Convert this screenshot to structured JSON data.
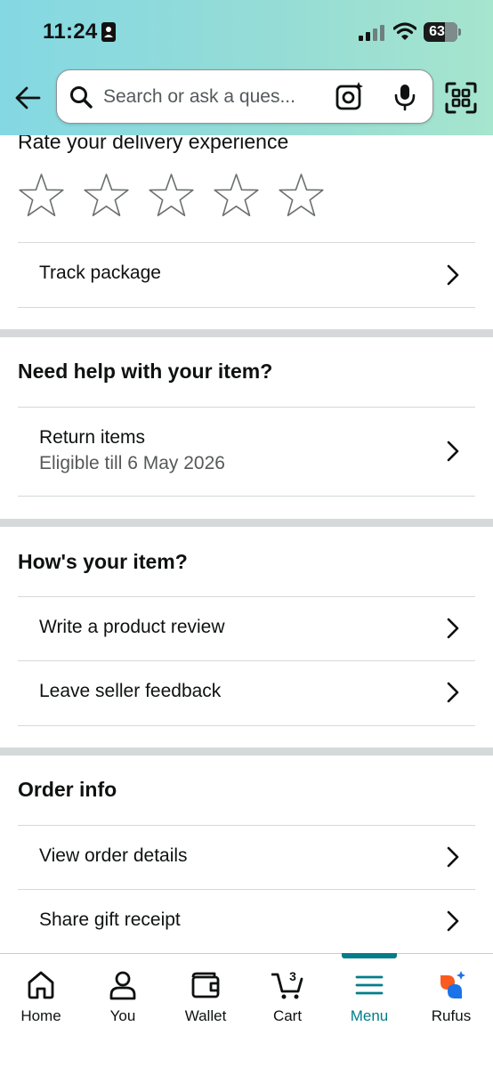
{
  "status_bar": {
    "time": "11:24",
    "battery": "63"
  },
  "search": {
    "placeholder": "Search or ask a ques..."
  },
  "rating": {
    "title": "Rate your delivery experience",
    "stars_total": 5,
    "stars_filled": 0
  },
  "delivery": {
    "track_label": "Track package"
  },
  "help_section": {
    "title": "Need help with your item?",
    "return_label": "Return items",
    "return_sub": "Eligible till 6 May 2026"
  },
  "item_section": {
    "title": "How's your item?",
    "review_label": "Write a product review",
    "feedback_label": "Leave seller feedback"
  },
  "order_section": {
    "title": "Order info",
    "details_label": "View order details",
    "gift_label": "Share gift receipt"
  },
  "bottom_nav": {
    "items": [
      {
        "label": "Home",
        "icon": "home-icon"
      },
      {
        "label": "You",
        "icon": "user-icon"
      },
      {
        "label": "Wallet",
        "icon": "wallet-icon"
      },
      {
        "label": "Cart",
        "icon": "cart-icon",
        "count": "3"
      },
      {
        "label": "Menu",
        "icon": "menu-icon",
        "active": true
      },
      {
        "label": "Rufus",
        "icon": "rufus-icon"
      }
    ]
  },
  "colors": {
    "header_gradient_start": "#84d8e3",
    "header_gradient_end": "#a6e5ce",
    "active_teal": "#007d89",
    "separator": "#d5d9d9"
  }
}
